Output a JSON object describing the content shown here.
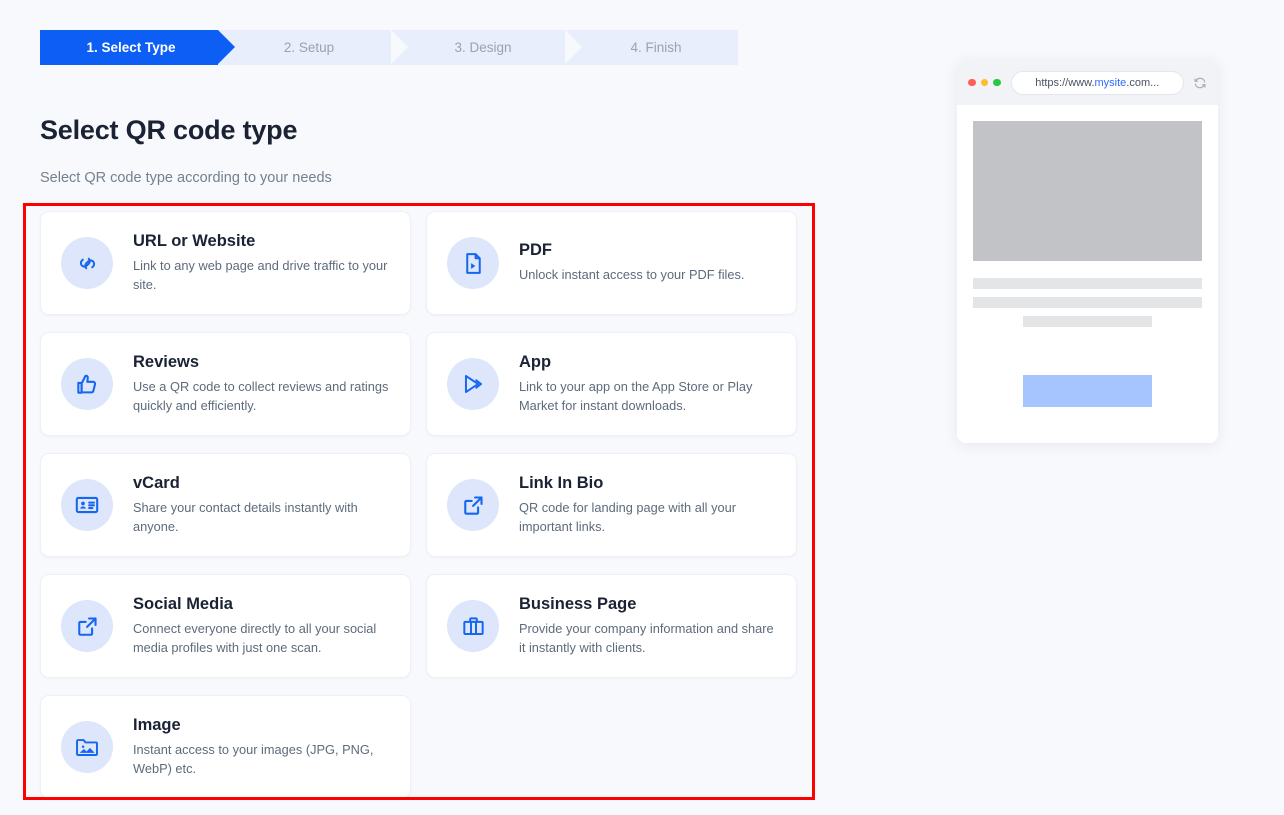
{
  "colors": {
    "accent": "#0d5ef4",
    "accent_icon": "#1566f0",
    "icon_bubble": "#dde6fb",
    "step_inactive_bg": "#e8eefb",
    "step_inactive_text": "#9aa3b0",
    "page_bg": "#f8f9fc",
    "highlight_border": "#ff0000",
    "card_bg": "#ffffff",
    "placeholder_gray": "#c2c3c6",
    "skeleton_gray": "#e4e5e7",
    "cta_blue": "#a6c4fd"
  },
  "stepper": {
    "steps": [
      {
        "label": "1. Select Type",
        "active": true
      },
      {
        "label": "2. Setup",
        "active": false
      },
      {
        "label": "3. Design",
        "active": false
      },
      {
        "label": "4. Finish",
        "active": false
      }
    ]
  },
  "header": {
    "title": "Select QR code type",
    "subtitle": "Select QR code type according to your needs"
  },
  "types": [
    {
      "title": "URL or Website",
      "desc": "Link to any web page and drive traffic to your site.",
      "icon": "link-icon"
    },
    {
      "title": "PDF",
      "desc": "Unlock instant access to your PDF files.",
      "icon": "pdf-file-icon"
    },
    {
      "title": "Reviews",
      "desc": "Use a QR code to collect reviews and ratings quickly and efficiently.",
      "icon": "thumbs-up-icon"
    },
    {
      "title": "App",
      "desc": "Link to your app on the App Store or Play Market for instant downloads.",
      "icon": "play-store-icon"
    },
    {
      "title": "vCard",
      "desc": "Share your contact details instantly with anyone.",
      "icon": "contact-card-icon"
    },
    {
      "title": "Link In Bio",
      "desc": "QR code for landing page with all your important links.",
      "icon": "external-link-icon"
    },
    {
      "title": "Social Media",
      "desc": "Connect everyone directly to all your social media profiles with just one scan.",
      "icon": "external-link-icon"
    },
    {
      "title": "Business Page",
      "desc": "Provide your company information and share it instantly with clients.",
      "icon": "briefcase-icon"
    },
    {
      "title": "Image",
      "desc": "Instant access to your images (JPG, PNG, WebP) etc.",
      "icon": "image-folder-icon"
    }
  ],
  "preview": {
    "url_prefix": "https://www.",
    "url_host": "mysite",
    "url_suffix": ".com...",
    "reload_icon": "refresh-icon",
    "traffic_lights": [
      "red",
      "yellow",
      "green"
    ]
  }
}
